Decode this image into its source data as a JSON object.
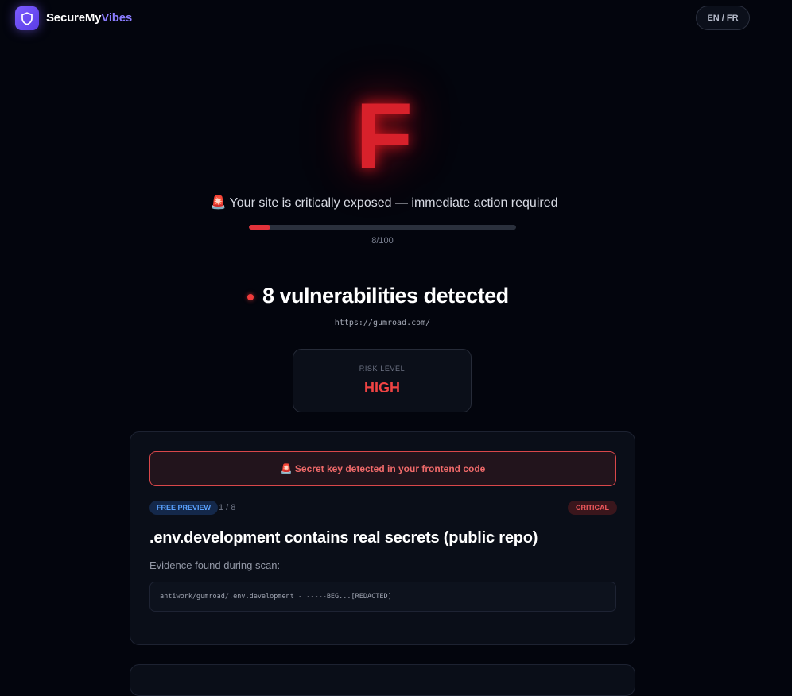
{
  "header": {
    "brand_part1": "SecureMy",
    "brand_part2": "Vibes",
    "logo_icon": "shield-icon",
    "lang_toggle": "EN / FR"
  },
  "grade": {
    "letter": "F",
    "status_text": "🚨 Your site is critically exposed — immediate action required",
    "score_text": "8/100",
    "score_fraction": 0.08
  },
  "scan": {
    "vuln_title": "8 vulnerabilities detected",
    "url": "https://gumroad.com/"
  },
  "risk": {
    "label": "RISK LEVEL",
    "value": "HIGH"
  },
  "finding": {
    "alert_text": "🚨 Secret key detected in your frontend code",
    "preview_badge": "FREE PREVIEW",
    "counter": "1 / 8",
    "severity": "CRITICAL",
    "title": ".env.development contains real secrets (public repo)",
    "evidence_label": "Evidence found during scan:",
    "evidence_value": "antiwork/gumroad/.env.development - -----BEG...[REDACTED]"
  },
  "colors": {
    "background": "#03050d",
    "grade_red": "#d8212b",
    "accent_purple": "#7c5cff",
    "critical_red": "#ef4343",
    "preview_blue": "#5aa2ff"
  }
}
